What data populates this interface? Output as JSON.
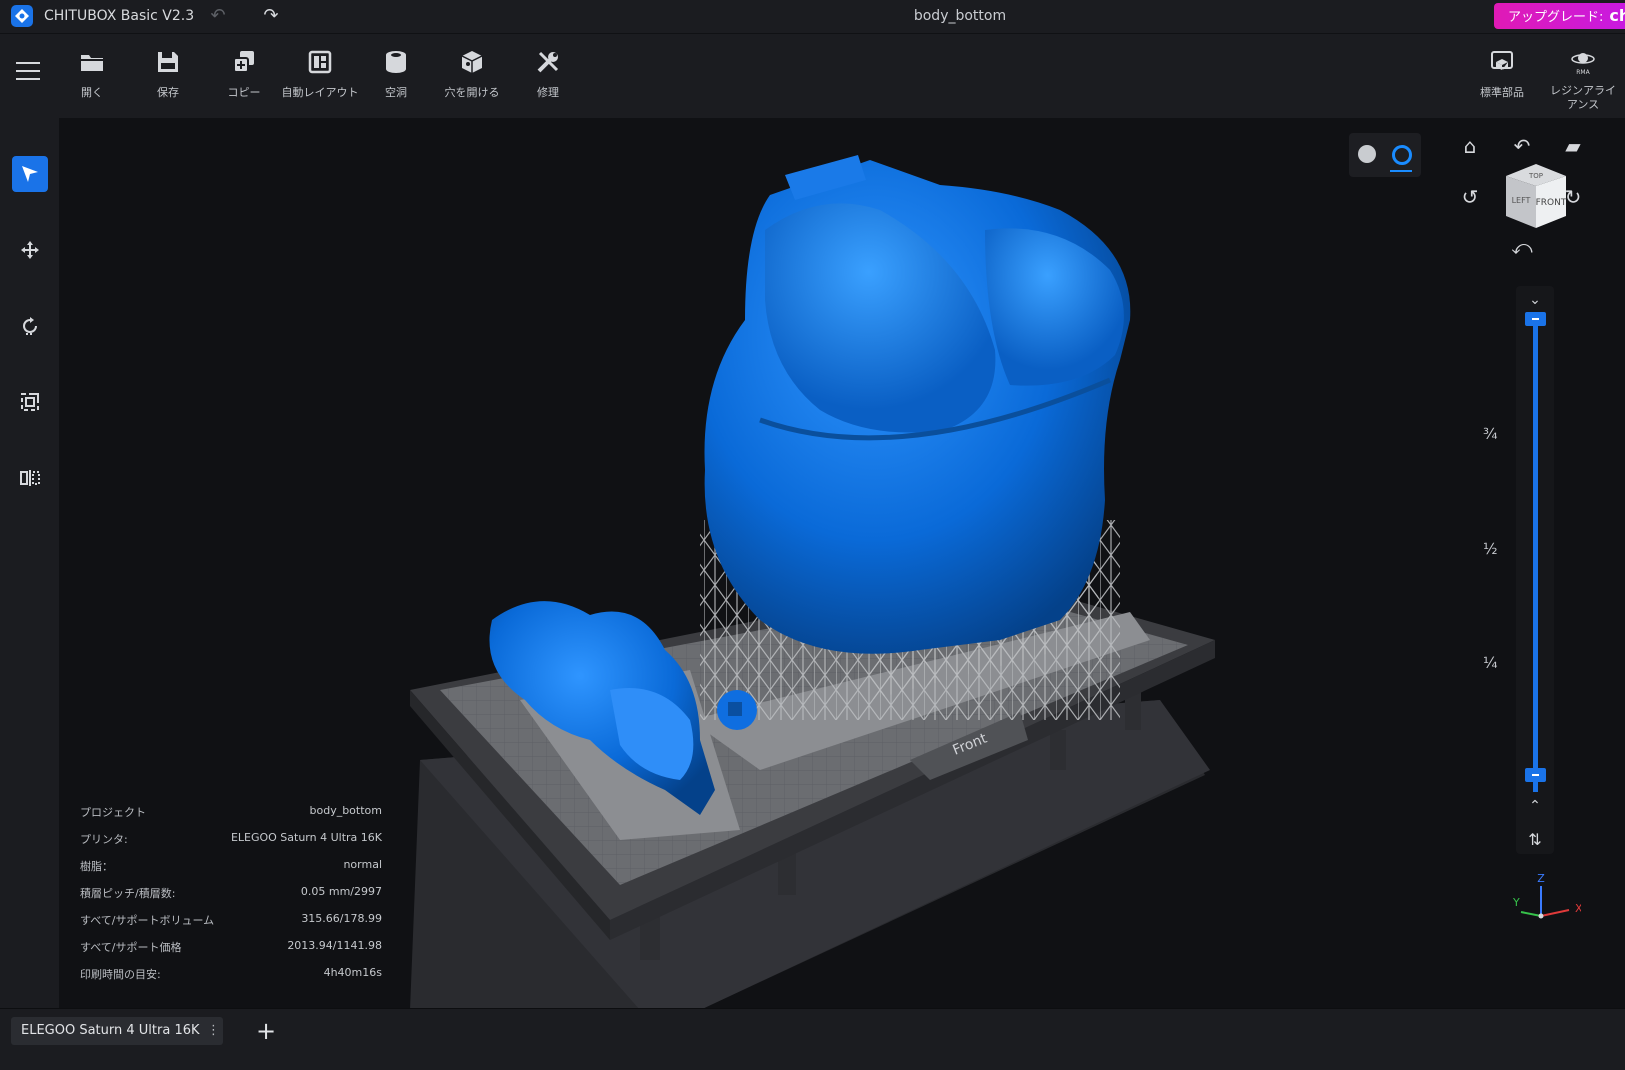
{
  "app": {
    "title": "CHITUBOX Basic V2.3",
    "document": "body_bottom",
    "upgrade_label": "アップグレード:",
    "upgrade_brand": "chit",
    "accent": "#1a73e8",
    "upgrade_color": "#e01ab5"
  },
  "toolbar": {
    "items": [
      {
        "label": "開く",
        "icon": "folder-icon"
      },
      {
        "label": "保存",
        "icon": "save-icon"
      },
      {
        "label": "コピー",
        "icon": "copy-icon"
      },
      {
        "label": "自動レイアウト",
        "icon": "auto-layout-icon"
      },
      {
        "label": "空洞",
        "icon": "hollow-icon"
      },
      {
        "label": "穴を開ける",
        "icon": "drill-hole-icon"
      },
      {
        "label": "修理",
        "icon": "repair-icon"
      }
    ],
    "right_items": [
      {
        "label": "標準部品",
        "icon": "standard-parts-icon"
      },
      {
        "label": "レジンアライアンス",
        "icon": "resin-alliance-icon",
        "badge": "RMA"
      }
    ]
  },
  "sidebar": {
    "tools": [
      "select-tool",
      "move-tool",
      "rotate-tool",
      "scale-tool",
      "mirror-tool"
    ],
    "active": "select-tool"
  },
  "view": {
    "cube_top": "TOP",
    "cube_front": "FRONT",
    "cube_left": "LEFT",
    "plate_label": "Front"
  },
  "slider": {
    "marks": [
      "¾",
      "½",
      "¼"
    ],
    "top_value": 1.0,
    "bottom_value": 0.0
  },
  "axes": {
    "x": "X",
    "y": "Y",
    "z": "Z"
  },
  "info": {
    "rows": [
      {
        "key": "プロジェクト",
        "value": "body_bottom"
      },
      {
        "key": "プリンタ:",
        "value": "ELEGOO Saturn 4 Ultra 16K"
      },
      {
        "key": "樹脂：",
        "value": "normal"
      },
      {
        "key": "積層ピッチ/積層数:",
        "value": "0.05 mm/2997"
      },
      {
        "key": "すべて/サポートボリューム",
        "value": "315.66/178.99"
      },
      {
        "key": "すべて/サポート価格",
        "value": "2013.94/1141.98"
      },
      {
        "key": "印刷時間の目安:",
        "value": "4h40m16s"
      }
    ]
  },
  "statusbar": {
    "printer_tab": "ELEGOO Saturn 4 Ultra 16K",
    "tab_menu": "⋮",
    "add": "+"
  }
}
